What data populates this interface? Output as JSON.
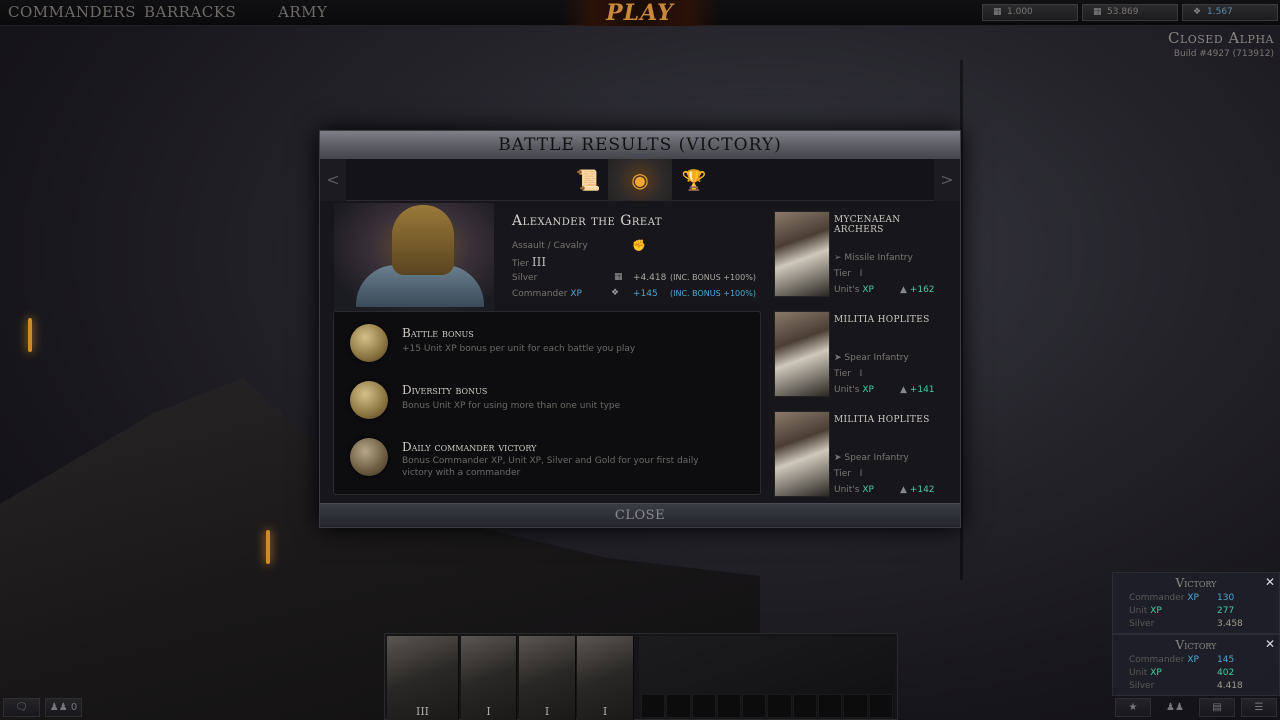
{
  "topbar": {
    "nav": [
      "COMMANDERS",
      "BARRACKS",
      "ARMY"
    ],
    "play_label": "PLAY",
    "resources": [
      {
        "icon": "gold-icon",
        "value": "1.000"
      },
      {
        "icon": "silver-icon",
        "value": "53.869"
      },
      {
        "icon": "commander-xp-icon",
        "value": "1.567"
      }
    ]
  },
  "build": {
    "title": "Closed Alpha",
    "build": "Build #4927 (713912)"
  },
  "dialog": {
    "title": "BATTLE RESULTS (VICTORY)",
    "tabs": [
      {
        "icon": "scroll-icon",
        "active": false
      },
      {
        "icon": "eye-icon",
        "active": true
      },
      {
        "icon": "trophy-icon",
        "active": false
      }
    ],
    "prev_arrow": "<",
    "next_arrow": ">",
    "commander": {
      "name": "Alexander the Great",
      "class": "Assault / Cavalry",
      "tier_label": "Tier",
      "tier": "III",
      "silver_label": "Silver",
      "silver_value": "+4.418",
      "silver_bonus": "(INC. BONUS +100%)",
      "xp_label": "Commander",
      "xp_suffix": "XP",
      "xp_value": "+145",
      "xp_bonus": "(INC. BONUS +100%)"
    },
    "bonuses": [
      {
        "title": "Battle bonus",
        "desc": "+15 Unit XP bonus per unit for each battle you play"
      },
      {
        "title": "Diversity bonus",
        "desc": "Bonus Unit XP for using more than one unit type"
      },
      {
        "title": "Daily commander victory",
        "desc": "Bonus Commander XP, Unit XP, Silver and Gold for your first daily victory with a commander"
      }
    ],
    "units": [
      {
        "name": "Mycenaean Archers",
        "type": "Missile Infantry",
        "tier_label": "Tier",
        "tier": "I",
        "xp_label": "Unit's",
        "xp_suffix": "XP",
        "xp": "+162"
      },
      {
        "name": "Militia Hoplites",
        "type": "Spear Infantry",
        "tier_label": "Tier",
        "tier": "I",
        "xp_label": "Unit's",
        "xp_suffix": "XP",
        "xp": "+141"
      },
      {
        "name": "Militia Hoplites",
        "type": "Spear Infantry",
        "tier_label": "Tier",
        "tier": "I",
        "xp_label": "Unit's",
        "xp_suffix": "XP",
        "xp": "+142"
      }
    ],
    "close_label": "CLOSE"
  },
  "notifications": [
    {
      "title": "Victory",
      "commander_label": "Commander",
      "unit_label": "Unit",
      "xp": "XP",
      "silver_label": "Silver",
      "commander_xp": "130",
      "unit_xp": "277",
      "silver": "3.458"
    },
    {
      "title": "Victory",
      "commander_label": "Commander",
      "unit_label": "Unit",
      "xp": "XP",
      "silver_label": "Silver",
      "commander_xp": "145",
      "unit_xp": "402",
      "silver": "4.418"
    }
  ],
  "army": {
    "slots": [
      {
        "tier": "III"
      },
      {
        "tier": "I"
      },
      {
        "tier": "I"
      },
      {
        "tier": "I"
      }
    ]
  },
  "bottom": {
    "friends_count": "0"
  },
  "colors": {
    "xp_blue": "#4fa5d6",
    "unit_xp_green": "#48c9a0",
    "play_orange": "#c8893a"
  }
}
